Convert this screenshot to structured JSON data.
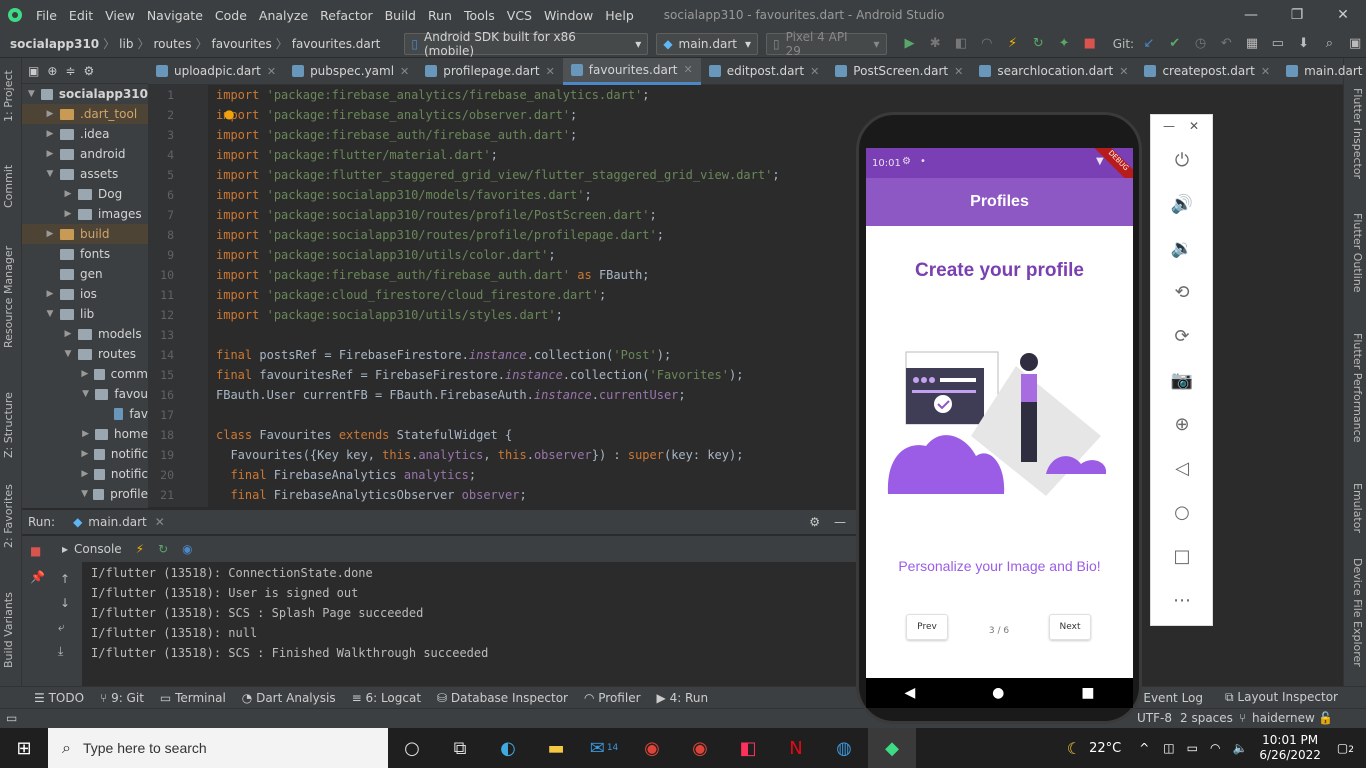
{
  "window": {
    "title": "socialapp310 - favourites.dart - Android Studio",
    "menu": [
      "File",
      "Edit",
      "View",
      "Navigate",
      "Code",
      "Analyze",
      "Refactor",
      "Build",
      "Run",
      "Tools",
      "VCS",
      "Window",
      "Help"
    ]
  },
  "toolbar": {
    "breadcrumbs": [
      "socialapp310",
      "lib",
      "routes",
      "favourites",
      "favourites.dart"
    ],
    "device_combo": "Android SDK built for x86 (mobile)",
    "run_config": "main.dart",
    "avd": "Pixel 4 API 29",
    "git_label": "Git:"
  },
  "left_strip": [
    "1: Project",
    "Commit",
    "Resource Manager",
    "Z: Structure",
    "2: Favorites",
    "Build Variants"
  ],
  "right_strip": [
    "Flutter Inspector",
    "Flutter Outline",
    "Flutter Performance",
    "Emulator",
    "Device File Explorer"
  ],
  "project": {
    "header": "1: Project",
    "root": "socialapp310",
    "tree": [
      {
        "label": ".dart_tool",
        "indent": 1,
        "arrow": "▶",
        "type": "orange",
        "excluded": true
      },
      {
        "label": ".idea",
        "indent": 1,
        "arrow": "▶",
        "type": "folder"
      },
      {
        "label": "android",
        "indent": 1,
        "arrow": "▶",
        "type": "folder"
      },
      {
        "label": "assets",
        "indent": 1,
        "arrow": "▼",
        "type": "folder"
      },
      {
        "label": "Dog",
        "indent": 2,
        "arrow": "▶",
        "type": "folder"
      },
      {
        "label": "images",
        "indent": 2,
        "arrow": "▶",
        "type": "folder"
      },
      {
        "label": "build",
        "indent": 1,
        "arrow": "▶",
        "type": "orange",
        "excluded": true
      },
      {
        "label": "fonts",
        "indent": 1,
        "arrow": "",
        "type": "folder"
      },
      {
        "label": "gen",
        "indent": 1,
        "arrow": "",
        "type": "folder"
      },
      {
        "label": "ios",
        "indent": 1,
        "arrow": "▶",
        "type": "folder"
      },
      {
        "label": "lib",
        "indent": 1,
        "arrow": "▼",
        "type": "folder"
      },
      {
        "label": "models",
        "indent": 2,
        "arrow": "▶",
        "type": "folder"
      },
      {
        "label": "routes",
        "indent": 2,
        "arrow": "▼",
        "type": "folder"
      },
      {
        "label": "comm",
        "indent": 3,
        "arrow": "▶",
        "type": "folder"
      },
      {
        "label": "favou",
        "indent": 3,
        "arrow": "▼",
        "type": "folder"
      },
      {
        "label": "fav",
        "indent": 4,
        "arrow": "",
        "type": "file"
      },
      {
        "label": "home",
        "indent": 3,
        "arrow": "▶",
        "type": "folder"
      },
      {
        "label": "notific",
        "indent": 3,
        "arrow": "▶",
        "type": "folder"
      },
      {
        "label": "notific",
        "indent": 3,
        "arrow": "▶",
        "type": "folder"
      },
      {
        "label": "profile",
        "indent": 3,
        "arrow": "▼",
        "type": "folder"
      }
    ]
  },
  "editor_tabs": [
    {
      "label": "uploadpic.dart",
      "active": false
    },
    {
      "label": "pubspec.yaml",
      "active": false
    },
    {
      "label": "profilepage.dart",
      "active": false
    },
    {
      "label": "favourites.dart",
      "active": true
    },
    {
      "label": "editpost.dart",
      "active": false
    },
    {
      "label": "PostScreen.dart",
      "active": false
    },
    {
      "label": "searchlocation.dart",
      "active": false
    },
    {
      "label": "createpost.dart",
      "active": false
    },
    {
      "label": "main.dart",
      "active": false
    }
  ],
  "code_lines": [
    {
      "n": "1",
      "html": "<span class='kw'>import</span> <span class='str'>'package:firebase_analytics/firebase_analytics.dart'</span>;"
    },
    {
      "n": "2",
      "html": "<span class='kw'>import</span> <span class='str'>'package:firebase_analytics/observer.dart'</span>;"
    },
    {
      "n": "3",
      "html": "<span class='kw'>import</span> <span class='str'>'package:firebase_auth/firebase_auth.dart'</span>;"
    },
    {
      "n": "4",
      "html": "<span class='kw'>import</span> <span class='str'>'package:flutter/material.dart'</span>;"
    },
    {
      "n": "5",
      "html": "<span class='kw'>import</span> <span class='str'>'package:flutter_staggered_grid_view/flutter_staggered_grid_view.dart'</span>;"
    },
    {
      "n": "6",
      "html": "<span class='kw'>import</span> <span class='str'>'package:socialapp310/models/favorites.dart'</span>;"
    },
    {
      "n": "7",
      "html": "<span class='kw'>import</span> <span class='str'>'package:socialapp310/routes/profile/PostScreen.dart'</span>;"
    },
    {
      "n": "8",
      "html": "<span class='kw'>import</span> <span class='str'>'package:socialapp310/routes/profile/profilepage.dart'</span>;"
    },
    {
      "n": "9",
      "html": "<span class='kw'>import</span> <span class='str'>'package:socialapp310/utils/color.dart'</span>;"
    },
    {
      "n": "10",
      "html": "<span class='kw'>import</span> <span class='str'>'package:firebase_auth/firebase_auth.dart'</span> <span class='kw'>as</span> FBauth;"
    },
    {
      "n": "11",
      "html": "<span class='kw'>import</span> <span class='str'>'package:cloud_firestore/cloud_firestore.dart'</span>;"
    },
    {
      "n": "12",
      "html": "<span class='kw'>import</span> <span class='str'>'package:socialapp310/utils/styles.dart'</span>;"
    },
    {
      "n": "13",
      "html": ""
    },
    {
      "n": "14",
      "html": "<span class='kw'>final</span> postsRef = FirebaseFirestore.<span class='it'>instance</span>.collection(<span class='str'>'Post'</span>);"
    },
    {
      "n": "15",
      "html": "<span class='kw'>final</span> favouritesRef = FirebaseFirestore.<span class='it'>instance</span>.collection(<span class='str'>'Favorites'</span>);"
    },
    {
      "n": "16",
      "html": "FBauth.User currentFB = FBauth.FirebaseAuth.<span class='it'>instance</span>.<span class='pur'>currentUser</span>;"
    },
    {
      "n": "17",
      "html": ""
    },
    {
      "n": "18",
      "html": "<span class='kw'>class</span> Favourites <span class='kw'>extends</span> StatefulWidget {"
    },
    {
      "n": "19",
      "html": "  Favourites({Key key, <span class='kw'>this</span>.<span class='pur'>analytics</span>, <span class='kw'>this</span>.<span class='pur'>observer</span>}) : <span class='kw'>super</span>(key: key);"
    },
    {
      "n": "20",
      "html": "  <span class='kw'>final</span> FirebaseAnalytics <span class='pur'>analytics</span>;"
    },
    {
      "n": "21",
      "html": "  <span class='kw'>final</span> FirebaseAnalyticsObserver <span class='pur'>observer</span>;"
    }
  ],
  "run": {
    "label": "Run:",
    "config_tab": "main.dart",
    "console_tab": "Console",
    "console_lines": [
      "I/flutter (13518): ConnectionState.done",
      "I/flutter (13518): User is signed out",
      "I/flutter (13518): SCS : Splash Page succeeded",
      "I/flutter (13518): null",
      "I/flutter (13518): SCS : Finished Walkthrough succeeded"
    ]
  },
  "bottom_tools": [
    "TODO",
    "9: Git",
    "Terminal",
    "Dart Analysis",
    "6: Logcat",
    "Database Inspector",
    "Profiler",
    "4: Run"
  ],
  "bottom_right_tools": [
    "Event Log",
    "Layout Inspector"
  ],
  "status": {
    "encoding": "UTF-8",
    "indent": "2 spaces",
    "branch": "haidernew"
  },
  "phone": {
    "status_time": "10:01",
    "debug_banner": "DEBUG",
    "appbar_title": "Profiles",
    "heading": "Create your profile",
    "subtitle": "Personalize your Image and Bio!",
    "prev_label": "Prev",
    "next_label": "Next",
    "page_indicator": "3 / 6"
  },
  "emulator_buttons": [
    "power-icon",
    "volume-up-icon",
    "volume-down-icon",
    "rotate-left-icon",
    "rotate-right-icon",
    "camera-icon",
    "zoom-icon",
    "back-icon",
    "home-icon",
    "overview-icon",
    "more-icon"
  ],
  "taskbar": {
    "search_placeholder": "Type here to search",
    "weather": "22°C",
    "time": "10:01 PM",
    "date": "6/26/2022",
    "notif_count": "2",
    "mail_badge": "14"
  },
  "colors": {
    "accent": "#4a88c7",
    "purple": "#8a4fc0",
    "appbar": "#8e58c4"
  }
}
